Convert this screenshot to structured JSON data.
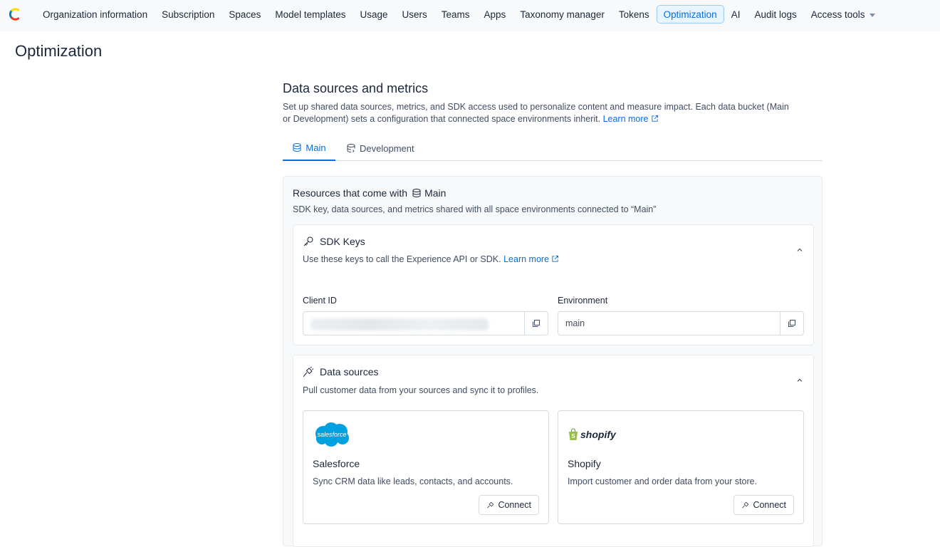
{
  "nav": {
    "items": [
      {
        "label": "Organization information"
      },
      {
        "label": "Subscription"
      },
      {
        "label": "Spaces"
      },
      {
        "label": "Model templates"
      },
      {
        "label": "Usage"
      },
      {
        "label": "Users"
      },
      {
        "label": "Teams"
      },
      {
        "label": "Apps"
      },
      {
        "label": "Taxonomy manager"
      },
      {
        "label": "Tokens"
      },
      {
        "label": "Optimization"
      },
      {
        "label": "AI"
      },
      {
        "label": "Audit logs"
      },
      {
        "label": "Access tools"
      }
    ],
    "active": "Optimization"
  },
  "page": {
    "title": "Optimization"
  },
  "section": {
    "title": "Data sources and metrics",
    "description": "Set up shared data sources, metrics, and SDK access used to personalize content and measure impact. Each data bucket (Main or Development) sets a configuration that connected space environments inherit.",
    "learn_more": "Learn more"
  },
  "tabs": [
    {
      "label": "Main"
    },
    {
      "label": "Development"
    }
  ],
  "panel": {
    "title_prefix": "Resources that come with",
    "title_bucket": "Main",
    "description": "SDK key, data sources, and metrics shared with all space environments connected to “Main”"
  },
  "sdk_keys": {
    "title": "SDK Keys",
    "description": "Use these keys to call the Experience API or SDK.",
    "learn_more": "Learn more",
    "client_id_label": "Client ID",
    "environment_label": "Environment",
    "environment_value": "main"
  },
  "data_sources": {
    "title": "Data sources",
    "description": "Pull customer data from your sources and sync it to profiles.",
    "sources": [
      {
        "logo_text": "salesforce",
        "name": "Salesforce",
        "description": "Sync CRM data like leads, contacts, and accounts.",
        "button": "Connect"
      },
      {
        "logo_text": "shopify",
        "name": "Shopify",
        "description": "Import customer and order data from your store.",
        "button": "Connect"
      }
    ]
  },
  "colors": {
    "accent": "#036fe3",
    "salesforce": "#00a1e0",
    "shopify": "#95bf47"
  }
}
